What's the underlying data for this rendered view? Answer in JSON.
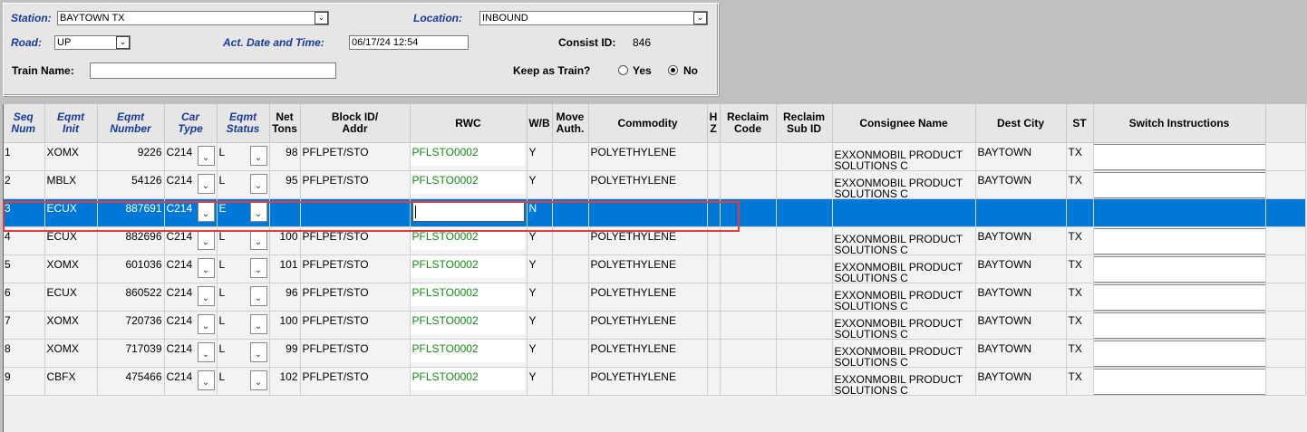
{
  "header": {
    "station_label": "Station:",
    "station_value": "BAYTOWN TX",
    "location_label": "Location:",
    "location_value": "INBOUND",
    "road_label": "Road:",
    "road_value": "UP",
    "act_datetime_label": "Act. Date and Time:",
    "act_datetime_value": "06/17/24 12:54",
    "consist_label": "Consist ID:",
    "consist_value": "846",
    "train_name_label": "Train Name:",
    "train_name_value": "",
    "keep_train_label": "Keep as Train?",
    "yes_label": "Yes",
    "no_label": "No",
    "keep_train_selected": "No"
  },
  "columns": [
    {
      "label": "Seq\nNum",
      "italic": true
    },
    {
      "label": "Eqmt\nInit",
      "italic": true
    },
    {
      "label": "Eqmt\nNumber",
      "italic": true
    },
    {
      "label": "Car\nType",
      "italic": true
    },
    {
      "label": "Eqmt\nStatus",
      "italic": true
    },
    {
      "label": "Net\nTons",
      "italic": false
    },
    {
      "label": "Block ID/\nAddr",
      "italic": false
    },
    {
      "label": "RWC",
      "italic": false
    },
    {
      "label": "W/B",
      "italic": false
    },
    {
      "label": "Move\nAuth.",
      "italic": false
    },
    {
      "label": "Commodity",
      "italic": false
    },
    {
      "label": "H\nZ",
      "italic": false
    },
    {
      "label": "Reclaim\nCode",
      "italic": false
    },
    {
      "label": "Reclaim\nSub ID",
      "italic": false
    },
    {
      "label": "Consignee Name",
      "italic": false
    },
    {
      "label": "Dest City",
      "italic": false
    },
    {
      "label": "ST",
      "italic": false
    },
    {
      "label": "Switch Instructions",
      "italic": false
    }
  ],
  "rows": [
    {
      "seq": "1",
      "init": "XOMX",
      "number": "9226",
      "car_type": "C214",
      "status": "L",
      "tons": "98",
      "block": "PFLPET/STO",
      "rwc": "PFLSTO0002",
      "wb": "Y",
      "move": "",
      "commodity": "POLYETHYLENE",
      "hz": "",
      "rcode": "",
      "rsub": "",
      "consignee": "EXXONMOBIL PRODUCT SOLUTIONS C",
      "dest": "BAYTOWN",
      "st": "TX"
    },
    {
      "seq": "2",
      "init": "MBLX",
      "number": "54126",
      "car_type": "C214",
      "status": "L",
      "tons": "95",
      "block": "PFLPET/STO",
      "rwc": "PFLSTO0002",
      "wb": "Y",
      "move": "",
      "commodity": "POLYETHYLENE",
      "hz": "",
      "rcode": "",
      "rsub": "",
      "consignee": "EXXONMOBIL PRODUCT SOLUTIONS C",
      "dest": "BAYTOWN",
      "st": "TX"
    },
    {
      "seq": "3",
      "init": "ECUX",
      "number": "887691",
      "car_type": "C214",
      "status": "E",
      "tons": "",
      "block": "",
      "rwc": "",
      "wb": "N",
      "move": "",
      "commodity": "",
      "hz": "",
      "rcode": "",
      "rsub": "",
      "consignee": "",
      "dest": "",
      "st": "",
      "selected": true
    },
    {
      "seq": "4",
      "init": "ECUX",
      "number": "882696",
      "car_type": "C214",
      "status": "L",
      "tons": "100",
      "block": "PFLPET/STO",
      "rwc": "PFLSTO0002",
      "wb": "Y",
      "move": "",
      "commodity": "POLYETHYLENE",
      "hz": "",
      "rcode": "",
      "rsub": "",
      "consignee": "EXXONMOBIL PRODUCT SOLUTIONS C",
      "dest": "BAYTOWN",
      "st": "TX"
    },
    {
      "seq": "5",
      "init": "XOMX",
      "number": "601036",
      "car_type": "C214",
      "status": "L",
      "tons": "101",
      "block": "PFLPET/STO",
      "rwc": "PFLSTO0002",
      "wb": "Y",
      "move": "",
      "commodity": "POLYETHYLENE",
      "hz": "",
      "rcode": "",
      "rsub": "",
      "consignee": "EXXONMOBIL PRODUCT SOLUTIONS C",
      "dest": "BAYTOWN",
      "st": "TX"
    },
    {
      "seq": "6",
      "init": "ECUX",
      "number": "860522",
      "car_type": "C214",
      "status": "L",
      "tons": "96",
      "block": "PFLPET/STO",
      "rwc": "PFLSTO0002",
      "wb": "Y",
      "move": "",
      "commodity": "POLYETHYLENE",
      "hz": "",
      "rcode": "",
      "rsub": "",
      "consignee": "EXXONMOBIL PRODUCT SOLUTIONS C",
      "dest": "BAYTOWN",
      "st": "TX"
    },
    {
      "seq": "7",
      "init": "XOMX",
      "number": "720736",
      "car_type": "C214",
      "status": "L",
      "tons": "100",
      "block": "PFLPET/STO",
      "rwc": "PFLSTO0002",
      "wb": "Y",
      "move": "",
      "commodity": "POLYETHYLENE",
      "hz": "",
      "rcode": "",
      "rsub": "",
      "consignee": "EXXONMOBIL PRODUCT SOLUTIONS C",
      "dest": "BAYTOWN",
      "st": "TX"
    },
    {
      "seq": "8",
      "init": "XOMX",
      "number": "717039",
      "car_type": "C214",
      "status": "L",
      "tons": "99",
      "block": "PFLPET/STO",
      "rwc": "PFLSTO0002",
      "wb": "Y",
      "move": "",
      "commodity": "POLYETHYLENE",
      "hz": "",
      "rcode": "",
      "rsub": "",
      "consignee": "EXXONMOBIL PRODUCT SOLUTIONS C",
      "dest": "BAYTOWN",
      "st": "TX"
    },
    {
      "seq": "9",
      "init": "CBFX",
      "number": "475466",
      "car_type": "C214",
      "status": "L",
      "tons": "102",
      "block": "PFLPET/STO",
      "rwc": "PFLSTO0002",
      "wb": "Y",
      "move": "",
      "commodity": "POLYETHYLENE",
      "hz": "",
      "rcode": "",
      "rsub": "",
      "consignee": "EXXONMOBIL PRODUCT SOLUTIONS C",
      "dest": "BAYTOWN",
      "st": "TX"
    }
  ],
  "colors": {
    "selected_row": "#0078d7",
    "label_blue": "#1a3a9a",
    "rwc_green": "#138a13",
    "highlight": "#e03c3c"
  },
  "icons": {
    "dropdown": "chevron-down-icon"
  }
}
